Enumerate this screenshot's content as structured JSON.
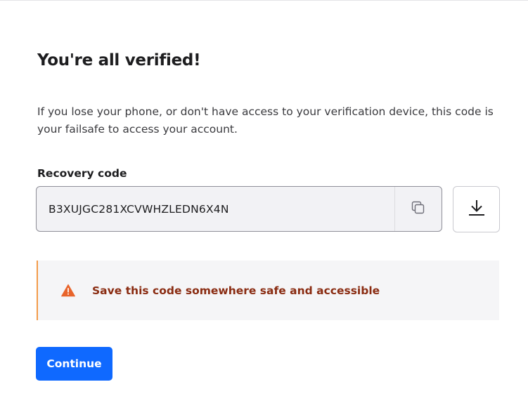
{
  "title": "You're all verified!",
  "description": "If you lose your phone, or don't have access to your verification device, this code is your failsafe to access your account.",
  "recovery": {
    "label": "Recovery code",
    "code": "B3XUJGC281XCVWHZLEDN6X4N",
    "copy_icon": "copy-icon",
    "download_icon": "download-icon"
  },
  "warning": {
    "icon": "warning-triangle-icon",
    "text": "Save this code somewhere safe and accessible",
    "accent_color": "#f39b4a",
    "text_color": "#8a2c12"
  },
  "continue_button": {
    "label": "Continue",
    "color": "#0f69ff"
  }
}
